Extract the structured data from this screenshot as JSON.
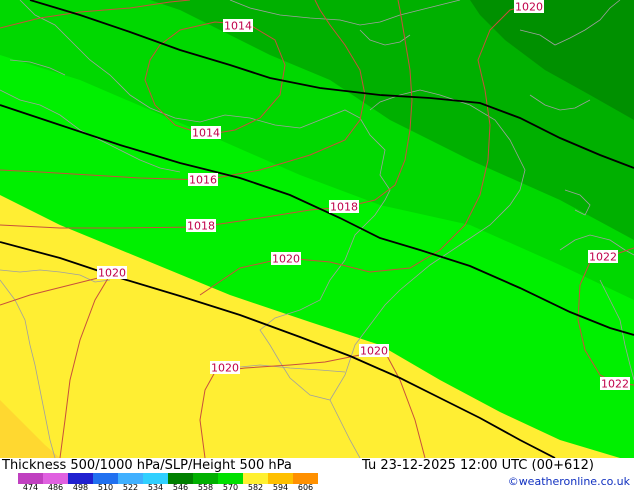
{
  "header": {
    "title": "Thickness 500/1000 hPa/SLP/Height 500 hPa",
    "datetime": "Tu 23-12-2025 12:00 UTC (00+612)",
    "credit": "©weatheronline.co.uk"
  },
  "legend": {
    "ticks": [
      "474",
      "486",
      "498",
      "510",
      "522",
      "534",
      "546",
      "558",
      "570",
      "582",
      "594",
      "606"
    ],
    "colors": [
      "#c040c0",
      "#e060e0",
      "#2020d0",
      "#2070f0",
      "#40b0ff",
      "#30d0ff",
      "#008000",
      "#00b000",
      "#00e000",
      "#fff030",
      "#ffc000",
      "#ff9000"
    ]
  },
  "map": {
    "isobar_labels": [
      "1014",
      "1014",
      "1016",
      "1018",
      "1018",
      "1020",
      "1020",
      "1020",
      "1020",
      "1020",
      "1022",
      "1022"
    ],
    "colors": {
      "isobar": "#c8503c",
      "height_line": "#000000",
      "coastline": "#a0a0a0",
      "green_dark": "#009000",
      "green_mid": "#00b000",
      "green_light": "#00d800",
      "green_bright": "#00f000",
      "yellow": "#ffee33",
      "yellow_deep": "#ffd830"
    }
  }
}
